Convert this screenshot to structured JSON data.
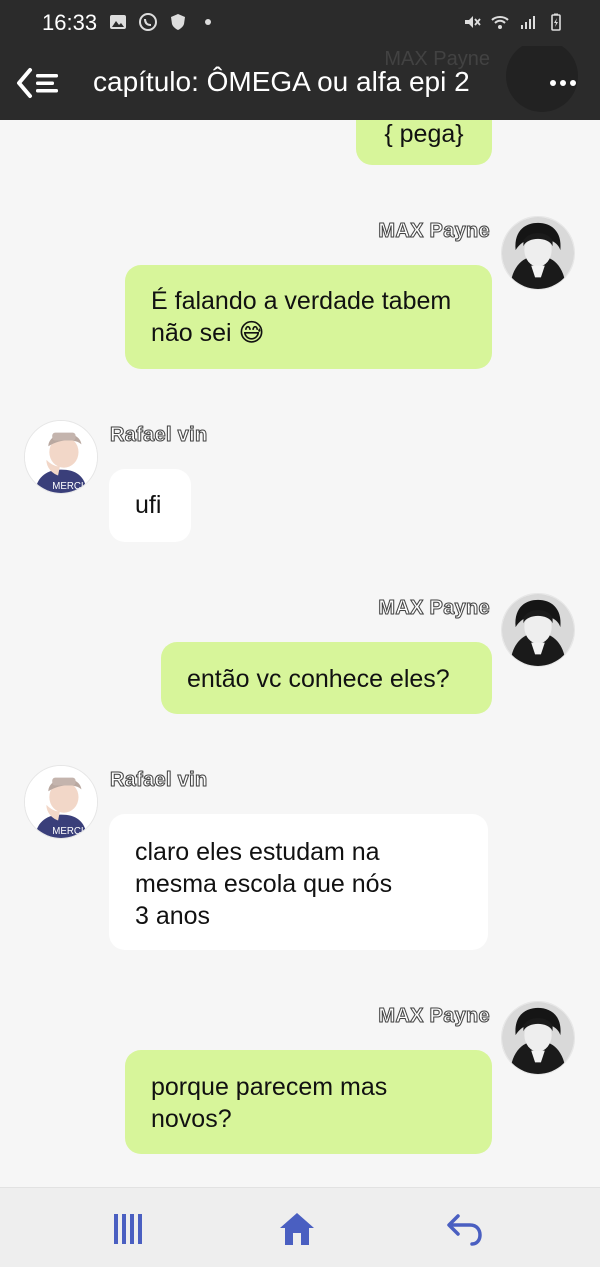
{
  "status_bar": {
    "time": "16:33"
  },
  "header": {
    "title": "capítulo: ÔMEGA ou alfa epi 2",
    "ghost_sender": "MAX Payne"
  },
  "messages": [
    {
      "sender": "",
      "side": "right",
      "text": "{ pega}"
    },
    {
      "sender": "MAX Payne",
      "side": "right",
      "text_line1": "É falando a verdade tabem",
      "text_line2": "não sei 😅"
    },
    {
      "sender": "Rafael vin",
      "side": "left",
      "text": "ufi"
    },
    {
      "sender": "MAX Payne",
      "side": "right",
      "text": "então vc conhece eles?"
    },
    {
      "sender": "Rafael vin",
      "side": "left",
      "text_line1": "claro eles estudam na",
      "text_line2": "mesma escola que nós",
      "text_line3": "3 anos"
    },
    {
      "sender": "MAX Payne",
      "side": "right",
      "text_line1": "porque parecem mas",
      "text_line2": "novos?"
    }
  ],
  "colors": {
    "bar_bg": "#2b2b2b",
    "bubble_green": "#d7f59a",
    "bubble_white": "#ffffff",
    "background": "#f6f6f6",
    "nav_icon": "#4a5fc1"
  },
  "icons": {
    "back": "back-menu-icon",
    "more": "more-vertical-icon",
    "nav_recents": "recent-apps-icon",
    "nav_home": "home-icon",
    "nav_back": "back-arrow-icon"
  }
}
